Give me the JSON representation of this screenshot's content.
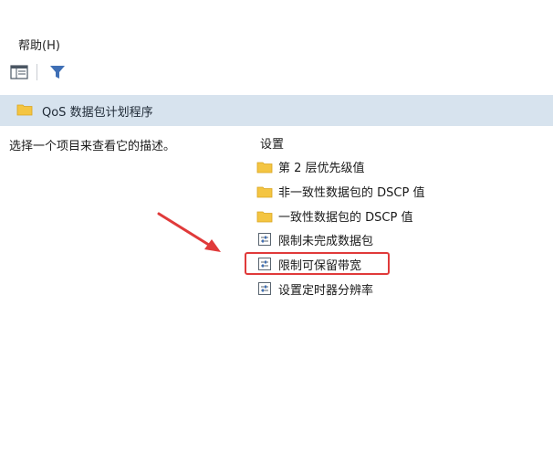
{
  "menu": {
    "help_label": "帮助(H)"
  },
  "toolbar": {
    "view_icon": "list-view-icon",
    "filter_icon": "filter-icon"
  },
  "header": {
    "title": "QoS 数据包计划程序"
  },
  "description": "选择一个项目来查看它的描述。",
  "settings": {
    "label": "设置",
    "items": [
      {
        "label": "第 2 层优先级值",
        "icon": "folder-icon"
      },
      {
        "label": "非一致性数据包的 DSCP 值",
        "icon": "folder-icon"
      },
      {
        "label": "一致性数据包的 DSCP 值",
        "icon": "folder-icon"
      },
      {
        "label": "限制未完成数据包",
        "icon": "policy-setting-icon"
      },
      {
        "label": "限制可保留带宽",
        "icon": "policy-setting-icon",
        "highlighted": true
      },
      {
        "label": "设置定时器分辨率",
        "icon": "policy-setting-icon"
      }
    ]
  },
  "colors": {
    "highlight": "#e03a3a",
    "header_band": "#d7e3ee",
    "folder": "#f4c542"
  }
}
